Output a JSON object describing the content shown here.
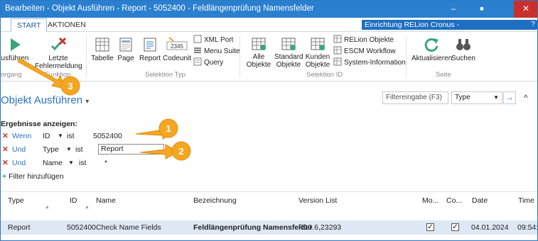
{
  "window": {
    "title": "Bearbeiten - Objekt Ausführen - Report - 5052400 - Feldlängenprüfung Namensfelder",
    "controls": {
      "minimize": "–",
      "maximize": "▫",
      "close": "✕"
    }
  },
  "ribbon_tabs": [
    "START",
    "AKTIONEN"
  ],
  "company": {
    "label": "Einrichtung RELion Cronus -",
    "help": "?"
  },
  "ribbon": {
    "run_label": "usführen",
    "last_error_label": [
      "Letzte",
      "Fehlermeldung"
    ],
    "group_process": "organg",
    "group_function": "Funktion",
    "table_label": "Tabelle",
    "page_label": "Page",
    "report_label": "Report",
    "codeunit_label": "Codeunit",
    "codeunit_icon_text": "2345",
    "xmlport_label": "XML Port",
    "menusuite_label": "Menu Suite",
    "query_label": "Query",
    "group_selection_type": "Selektion Typ",
    "all_objects_label": [
      "Alle",
      "Objekte"
    ],
    "standard_objects_label": [
      "Standard",
      "Objekte"
    ],
    "customer_objects_label": [
      "Kunden",
      "Objekte"
    ],
    "relion_objects_label": "RELion Objekte",
    "escm_label": "ESCM Workflow",
    "sysinfo_label": "System-Information",
    "group_selection_id": "Selektion ID",
    "refresh_label": "Aktualisieren",
    "search_label": "Suchen",
    "group_page": "Seite"
  },
  "page": {
    "title": "Objekt Ausführen",
    "title_caret": "▾",
    "filter_placeholder": "Filtereingabe (F3)",
    "filter_type": "Type",
    "go_arrow": "→",
    "collapse": "^"
  },
  "filters": {
    "results_label": "Ergebnisse anzeigen:",
    "rows": [
      {
        "keyword": "Wenn",
        "field": "ID",
        "op": "ist",
        "value": "5052400"
      },
      {
        "keyword": "Und",
        "field": "Type",
        "op": "ist",
        "value": "Report"
      },
      {
        "keyword": "Und",
        "field": "Name",
        "op": "ist",
        "value": "*"
      }
    ],
    "add_filter": "Filter hinzufügen"
  },
  "grid": {
    "columns": [
      "Type",
      "ID",
      "Name",
      "Bezeichnung",
      "Version List",
      "Mo...",
      "Co...",
      "Date",
      "Time"
    ],
    "rows": [
      {
        "type": "Report",
        "id": "5052400",
        "name": "Check Name Fields",
        "bezeichnung": "Feldlängenprüfung Namensfelder",
        "version": "R10.6,23293",
        "mo": "✓",
        "co": "✓",
        "date": "04.01.2024",
        "time": "09:54:"
      }
    ]
  },
  "callouts": [
    "1",
    "2",
    "3"
  ],
  "colors": {
    "accent": "#2a7fcf",
    "callout": "#f5a623",
    "grid_selected": "#dde8f4"
  }
}
